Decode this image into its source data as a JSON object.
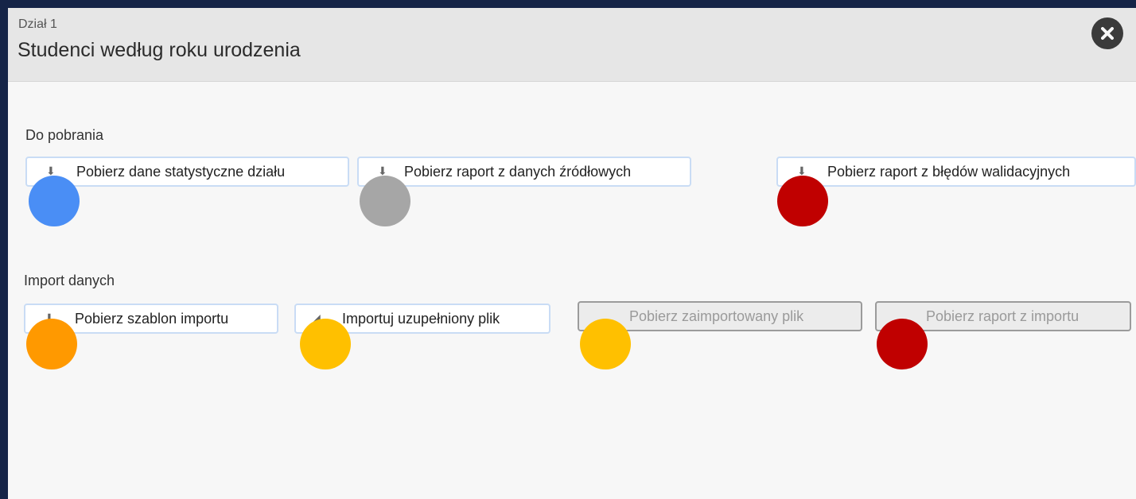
{
  "dialog": {
    "subtitle": "Dział 1",
    "title": "Studenci według roku urodzenia",
    "close_icon": "close-icon"
  },
  "downloads": {
    "label": "Do pobrania",
    "buttons": [
      {
        "label": "Pobierz dane statystyczne działu",
        "icon": "download-icon"
      },
      {
        "label": "Pobierz raport z danych źródłowych",
        "icon": "download-icon"
      },
      {
        "label": "Pobierz raport z błędów walidacyjnych",
        "icon": "download-icon"
      }
    ]
  },
  "import": {
    "label": "Import danych",
    "buttons": [
      {
        "label": "Pobierz szablon importu",
        "icon": "download-icon",
        "enabled": true
      },
      {
        "label": "Importuj uzupełniony plik",
        "icon": "send-icon",
        "enabled": true
      },
      {
        "label": "Pobierz zaimportowany plik",
        "enabled": false
      },
      {
        "label": "Pobierz raport z importu",
        "enabled": false
      }
    ]
  },
  "status_colors": {
    "blue": "#4a8ef5",
    "gray": "#a6a6a6",
    "red": "#c00000",
    "orange": "#ff9900",
    "yellow": "#ffc000"
  }
}
